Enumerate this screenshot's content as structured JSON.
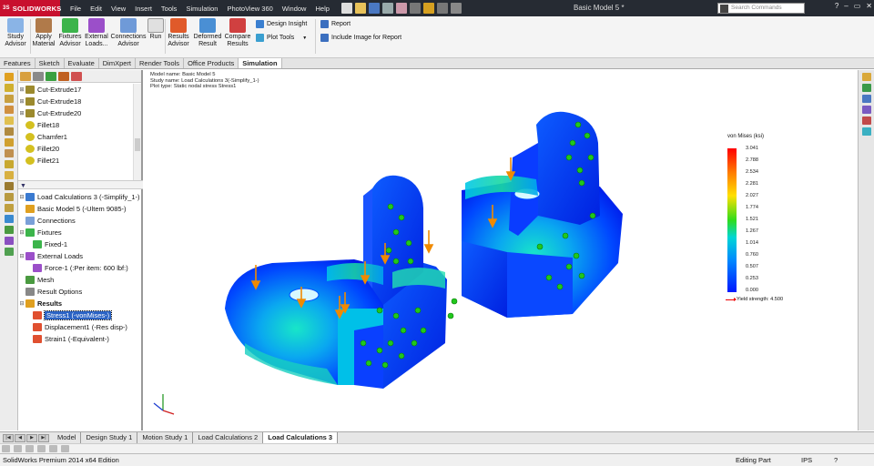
{
  "app": {
    "logo_text": "SOLIDWORKS",
    "brand_prefix": "3S",
    "document_title": "Basic Model 5 *"
  },
  "menus": [
    "File",
    "Edit",
    "View",
    "Insert",
    "Tools",
    "Simulation",
    "PhotoView 360",
    "Window",
    "Help"
  ],
  "search": {
    "placeholder": "Search Commands"
  },
  "ribbon": {
    "study_advisor": "Study\nAdvisor",
    "apply_material": "Apply\nMaterial",
    "fixtures_advisor": "Fixtures\nAdvisor",
    "external_loads": "External\nLoads...",
    "connections_advisor": "Connections\nAdvisor",
    "run": "Run",
    "results_advisor": "Results\nAdvisor",
    "deformed_result": "Deformed\nResult",
    "compare_results": "Compare\nResults",
    "design_insight": "Design Insight",
    "plot_tools": "Plot Tools",
    "report": "Report",
    "include_image": "Include Image for Report"
  },
  "command_tabs": [
    "Features",
    "Sketch",
    "Evaluate",
    "DimXpert",
    "Render Tools",
    "Office Products",
    "Simulation"
  ],
  "active_command_tab": "Simulation",
  "feature_tree": [
    {
      "label": "Cut-Extrude17",
      "icon_color": "#9c8a2e"
    },
    {
      "label": "Cut-Extrude18",
      "icon_color": "#9c8a2e"
    },
    {
      "label": "Cut-Extrude20",
      "icon_color": "#9c8a2e"
    },
    {
      "label": "Fillet18",
      "icon_color": "#d4c020"
    },
    {
      "label": "Chamfer1",
      "icon_color": "#d4c020"
    },
    {
      "label": "Fillet20",
      "icon_color": "#d4c020"
    },
    {
      "label": "Fillet21",
      "icon_color": "#d4c020"
    }
  ],
  "study_tree": {
    "root": "Load Calculations 3 (-Simplify_1-)",
    "part": "Basic Model 5 (-Ultem 9085-)",
    "connections": "Connections",
    "fixtures": "Fixtures",
    "fixed": "Fixed-1",
    "external_loads": "External Loads",
    "force": "Force-1 (:Per item: 600 lbf:)",
    "mesh": "Mesh",
    "result_options": "Result Options",
    "results": "Results",
    "stress": "Stress1 (-vonMises-)",
    "displacement": "Displacement1 (-Res disp-)",
    "strain": "Strain1 (-Equivalent-)"
  },
  "study_info": {
    "model_name": "Model name: Basic Model 5",
    "study_name": "Study name: Load Calculations 3(-Simplify_1-)",
    "plot_type": "Plot type: Static nodal stress Stress1"
  },
  "legend": {
    "title": "von Mises (ksi)",
    "values": [
      "3.041",
      "2.788",
      "2.534",
      "2.281",
      "2.027",
      "1.774",
      "1.521",
      "1.267",
      "1.014",
      "0.760",
      "0.507",
      "0.253",
      "0.000"
    ],
    "yield": "Yield strength: 4.500",
    "yield_color": "#e00000"
  },
  "bottom_tabs": [
    "Model",
    "Design Study 1",
    "Motion Study 1",
    "Load Calculations 2",
    "Load Calculations 3"
  ],
  "active_bottom_tab": "Load Calculations 3",
  "status": {
    "left": "SolidWorks Premium 2014 x64 Edition",
    "mode": "Editing Part",
    "units": "IPS",
    "help": "?"
  },
  "colors": {
    "title_bar": "#262b33",
    "logo_red": "#c8102e",
    "selection_blue": "#2b63c4",
    "load_arrow": "#f08a00",
    "fixture_green": "#22cc22"
  }
}
